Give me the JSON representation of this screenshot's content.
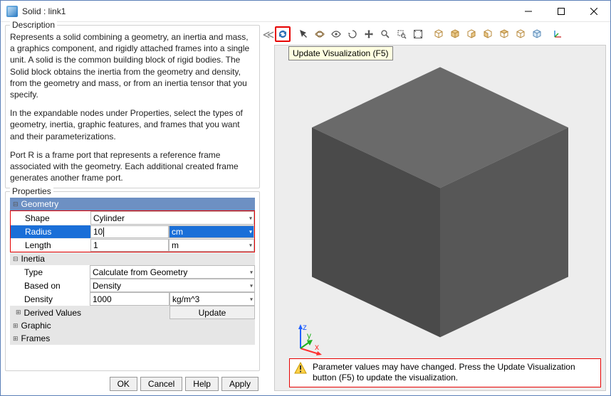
{
  "window": {
    "title": "Solid : link1"
  },
  "description": {
    "legend": "Description",
    "p1": "Represents a solid combining a geometry, an inertia and mass, a graphics component, and rigidly attached frames into a single unit. A solid is the common building block of rigid bodies. The Solid block obtains the inertia from the geometry and density, from the geometry and mass, or from an inertia tensor that you specify.",
    "p2": "In the expandable nodes under Properties, select the types of geometry, inertia, graphic features, and frames that you want and their parameterizations.",
    "p3": "Port R is a frame port that represents a reference frame associated with the geometry. Each additional created frame generates another frame port."
  },
  "properties": {
    "legend": "Properties",
    "geometry": {
      "header": "Geometry",
      "shape_label": "Shape",
      "shape_value": "Cylinder",
      "radius_label": "Radius",
      "radius_value": "10",
      "radius_unit": "cm",
      "length_label": "Length",
      "length_value": "1",
      "length_unit": "m"
    },
    "inertia": {
      "header": "Inertia",
      "type_label": "Type",
      "type_value": "Calculate from Geometry",
      "basedon_label": "Based on",
      "basedon_value": "Density",
      "density_label": "Density",
      "density_value": "1000",
      "density_unit": "kg/m^3",
      "derived_label": "Derived Values",
      "update_btn": "Update"
    },
    "graphic": {
      "header": "Graphic"
    },
    "frames": {
      "header": "Frames"
    }
  },
  "buttons": {
    "ok": "OK",
    "cancel": "Cancel",
    "help": "Help",
    "apply": "Apply"
  },
  "tooltip": "Update Visualization (F5)",
  "warning": "Parameter values may have changed. Press the Update Visualization button (F5) to update the visualization.",
  "splitter_glyph": "≪",
  "axis_labels": {
    "x": "x",
    "y": "y",
    "z": "z"
  }
}
